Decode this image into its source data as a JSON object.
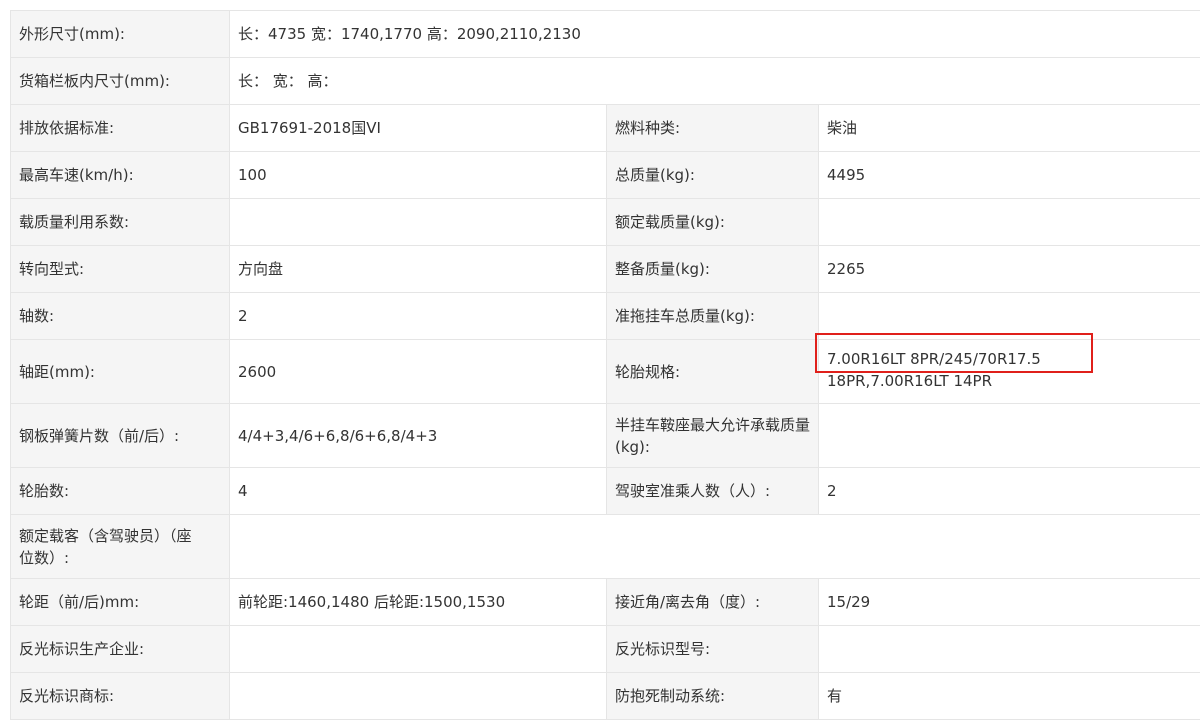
{
  "rows": [
    {
      "label1": "外形尺寸(mm):",
      "value1": "长：4735 宽：1740,1770 高：2090,2110,2130"
    },
    {
      "label1": "货箱栏板内尺寸(mm):",
      "value1": "长：  宽：  高："
    },
    {
      "label1": "排放依据标准:",
      "value1": "GB17691-2018国VI",
      "label2": "燃料种类:",
      "value2": "柴油"
    },
    {
      "label1": "最高车速(km/h):",
      "value1": "100",
      "label2": "总质量(kg):",
      "value2": "4495"
    },
    {
      "label1": "载质量利用系数:",
      "value1": "",
      "label2": "额定载质量(kg):",
      "value2": ""
    },
    {
      "label1": "转向型式:",
      "value1": "方向盘",
      "label2": "整备质量(kg):",
      "value2": "2265"
    },
    {
      "label1": "轴数:",
      "value1": "2",
      "label2": "准拖挂车总质量(kg):",
      "value2": ""
    },
    {
      "label1": "轴距(mm):",
      "value1": "2600",
      "label2": "轮胎规格:",
      "value2": "7.00R16LT 8PR/245/70R17.5 18PR,7.00R16LT 14PR"
    },
    {
      "label1": "钢板弹簧片数（前/后）:",
      "value1": "4/4+3,4/6+6,8/6+6,8/4+3",
      "label2": "半挂车鞍座最大允许承载质量(kg):",
      "value2": ""
    },
    {
      "label1": "轮胎数:",
      "value1": "4",
      "label2": "驾驶室准乘人数（人）:",
      "value2": "2"
    },
    {
      "label1": "额定载客（含驾驶员）（座位数）:",
      "value1": ""
    },
    {
      "label1": "轮距（前/后)mm:",
      "value1": "前轮距:1460,1480 后轮距:1500,1530",
      "label2": "接近角/离去角（度）:",
      "value2": "15/29"
    },
    {
      "label1": "反光标识生产企业:",
      "value1": "",
      "label2": "反光标识型号:",
      "value2": ""
    },
    {
      "label1": "反光标识商标:",
      "value1": "",
      "label2": "防抱死制动系统:",
      "value2": "有"
    }
  ],
  "highlight_color": "#e0201b"
}
